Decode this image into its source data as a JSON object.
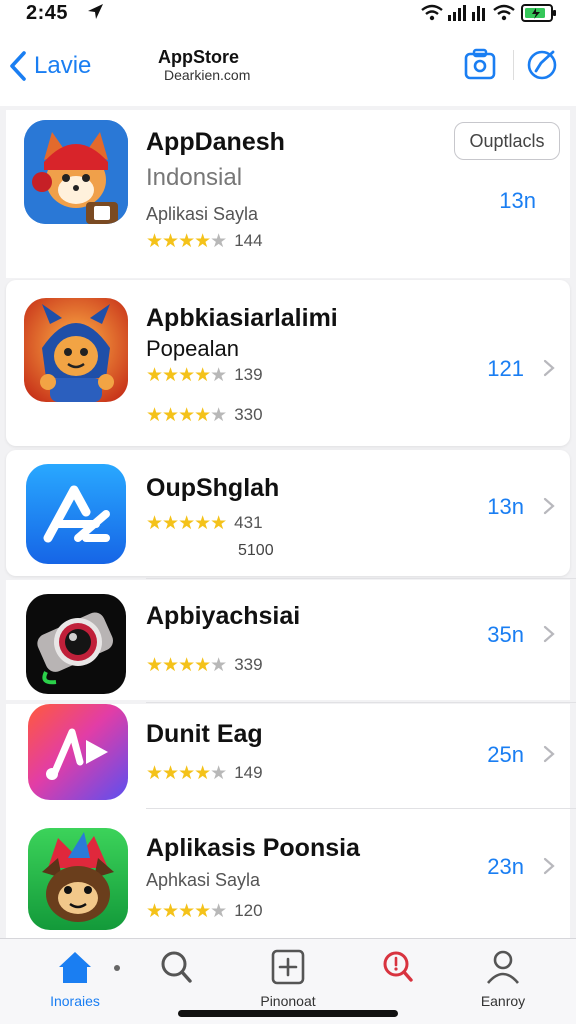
{
  "status_bar": {
    "time": "2:45"
  },
  "nav": {
    "back_label": "Lavie",
    "title": "AppStore",
    "subtitle": "Dearkien.com"
  },
  "apps": [
    {
      "name": "AppDanesh",
      "subtitle": "Indonsial",
      "category": "Aplikasi Sayla",
      "rating": 4.5,
      "rating_count": "144",
      "size": "13n",
      "button_label": "Ouptlacls",
      "icon": "fox-helmet-icon"
    },
    {
      "name": "Apbkiasiarlalimi",
      "subtitle": "Popealan",
      "rating": 4.5,
      "rating_count": "139",
      "rating2_count": "330",
      "size": "121",
      "icon": "hooded-fox-icon"
    },
    {
      "name": "OupShglah",
      "rating": 4.5,
      "rating_count": "431",
      "extra_count": "5100",
      "size": "13n",
      "icon": "app-store-a-icon"
    },
    {
      "name": "Apbiyachsiai",
      "rating": 4.5,
      "rating_count": "339",
      "size": "35n",
      "icon": "camera-lens-icon"
    },
    {
      "name": "Dunit Eag",
      "rating": 4.5,
      "rating_count": "149",
      "size": "25n",
      "icon": "music-play-icon"
    },
    {
      "name": "Aplikasis Poonsia",
      "subtitle": "Aphkasi Sayla",
      "rating": 4.5,
      "rating_count": "120",
      "size": "23n",
      "icon": "jester-cat-icon"
    }
  ],
  "tabs": [
    {
      "label": "Inoraies",
      "icon": "home-icon",
      "active": true
    },
    {
      "label": "",
      "icon": "search-icon",
      "active": false
    },
    {
      "label": "Pinonoat",
      "icon": "add-box-icon",
      "active": false
    },
    {
      "label": "",
      "icon": "search-alert-icon",
      "active": false
    },
    {
      "label": "Eanroy",
      "icon": "person-icon",
      "active": false
    }
  ],
  "colors": {
    "accent": "#1a7ef2",
    "star": "#f4c21a",
    "background": "#f2f2f4"
  }
}
